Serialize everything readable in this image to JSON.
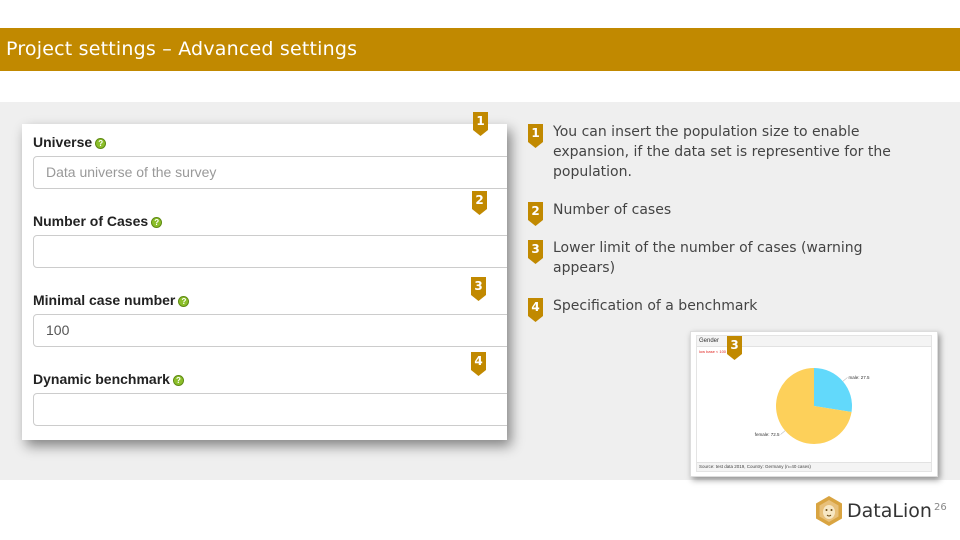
{
  "slide": {
    "title": "Project settings – Advanced settings",
    "page_number": "26"
  },
  "form": {
    "fields": [
      {
        "label": "Universe",
        "value": "",
        "placeholder": "Data universe of the survey",
        "help_icon": "question-icon"
      },
      {
        "label": "Number of Cases",
        "value": "",
        "placeholder": "",
        "help_icon": "question-icon"
      },
      {
        "label": "Minimal case number",
        "value": "100",
        "placeholder": "",
        "help_icon": "question-icon"
      },
      {
        "label": "Dynamic benchmark",
        "value": "",
        "placeholder": "",
        "help_icon": "question-icon"
      }
    ],
    "help_glyph": "?"
  },
  "markers": {
    "m1": "1",
    "m2": "2",
    "m3": "3",
    "m4": "4",
    "chart_marker": "3"
  },
  "descriptions": [
    {
      "number": "1",
      "text": "You can insert the population size to enable expansion, if the data set is representive for the population."
    },
    {
      "number": "2",
      "text": "Number of cases"
    },
    {
      "number": "3",
      "text": "Lower limit of the number of cases (warning appears)"
    },
    {
      "number": "4",
      "text": "Specification of a benchmark"
    }
  ],
  "chart_data": {
    "type": "pie",
    "title": "Gender",
    "warning": "low base < 100",
    "labels": [
      "male",
      "female"
    ],
    "values": [
      27.5,
      72.5
    ],
    "data_labels": [
      "male: 27.5",
      "female: 72.5"
    ],
    "colors": [
      "#62d9fb",
      "#fdd05a"
    ],
    "source": "Source: test data 2019, Country: Germany (n=40 cases)"
  },
  "colors": {
    "accent": "#c18900",
    "marker": "#c18900",
    "help_dot": "#8cbf2a"
  },
  "logo": {
    "name": "DataLion",
    "icon": "lion-icon"
  }
}
